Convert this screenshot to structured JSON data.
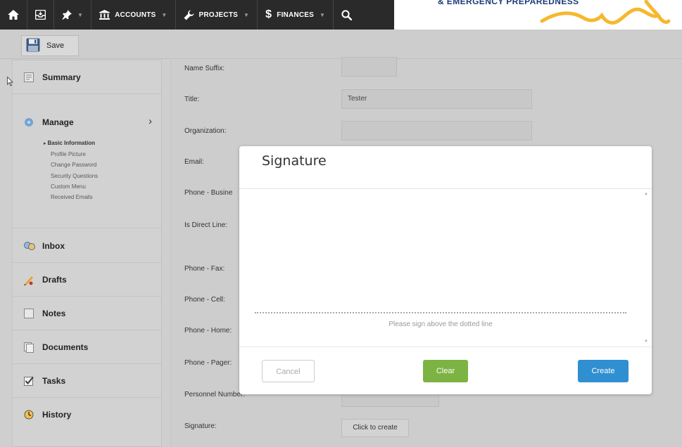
{
  "nav": {
    "items": [
      {
        "icon": "home-icon"
      },
      {
        "icon": "inbox-tray-icon"
      },
      {
        "icon": "pin-icon",
        "has_caret": true
      },
      {
        "icon": "bank-icon",
        "label": "ACCOUNTS",
        "has_caret": true
      },
      {
        "icon": "wrench-icon",
        "label": "PROJECTS",
        "has_caret": true
      },
      {
        "icon": "dollar-icon",
        "label": "FINANCES",
        "has_caret": true
      },
      {
        "icon": "search-icon"
      }
    ],
    "logo_text": "& EMERGENCY PREPAREDNESS",
    "colors": {
      "bar": "#2a2a2a",
      "logo_text": "#1d3b78",
      "logo_swoosh": "#f5b82e"
    }
  },
  "toolbar": {
    "save_label": "Save"
  },
  "sidebar": {
    "items": [
      {
        "label": "Summary",
        "icon": "summary-icon"
      },
      {
        "label": "Manage",
        "icon": "gear-icon"
      },
      {
        "label": "Inbox",
        "icon": "inbox-icon"
      },
      {
        "label": "Drafts",
        "icon": "drafts-icon"
      },
      {
        "label": "Notes",
        "icon": "notes-icon"
      },
      {
        "label": "Documents",
        "icon": "documents-icon"
      },
      {
        "label": "Tasks",
        "icon": "tasks-check-icon"
      },
      {
        "label": "History",
        "icon": "history-clock-icon"
      }
    ],
    "manage_subitems": [
      "Basic Information",
      "Profile Picture",
      "Change Password",
      "Security Questions",
      "Custom Menu",
      "Received Emails"
    ],
    "active_subitem": "Basic Information"
  },
  "form": {
    "fields": [
      {
        "label": "Name Suffix:",
        "value": ""
      },
      {
        "label": "Title:",
        "value": "Tester"
      },
      {
        "label": "Organization:",
        "value": ""
      },
      {
        "label": "Email:"
      },
      {
        "label": "Phone - Busine"
      },
      {
        "label": "Is Direct Line:"
      },
      {
        "label": "Phone - Fax:"
      },
      {
        "label": "Phone - Cell:"
      },
      {
        "label": "Phone - Home:"
      },
      {
        "label": "Phone - Pager:"
      },
      {
        "label": "Personnel Number:"
      },
      {
        "label": "Signature:"
      }
    ],
    "signature_button": "Click to create"
  },
  "modal": {
    "title": "Signature",
    "hint": "Please sign above the dotted line",
    "cancel_label": "Cancel",
    "clear_label": "Clear",
    "create_label": "Create",
    "colors": {
      "clear": "#7cb342",
      "create": "#2f8fd1"
    }
  }
}
